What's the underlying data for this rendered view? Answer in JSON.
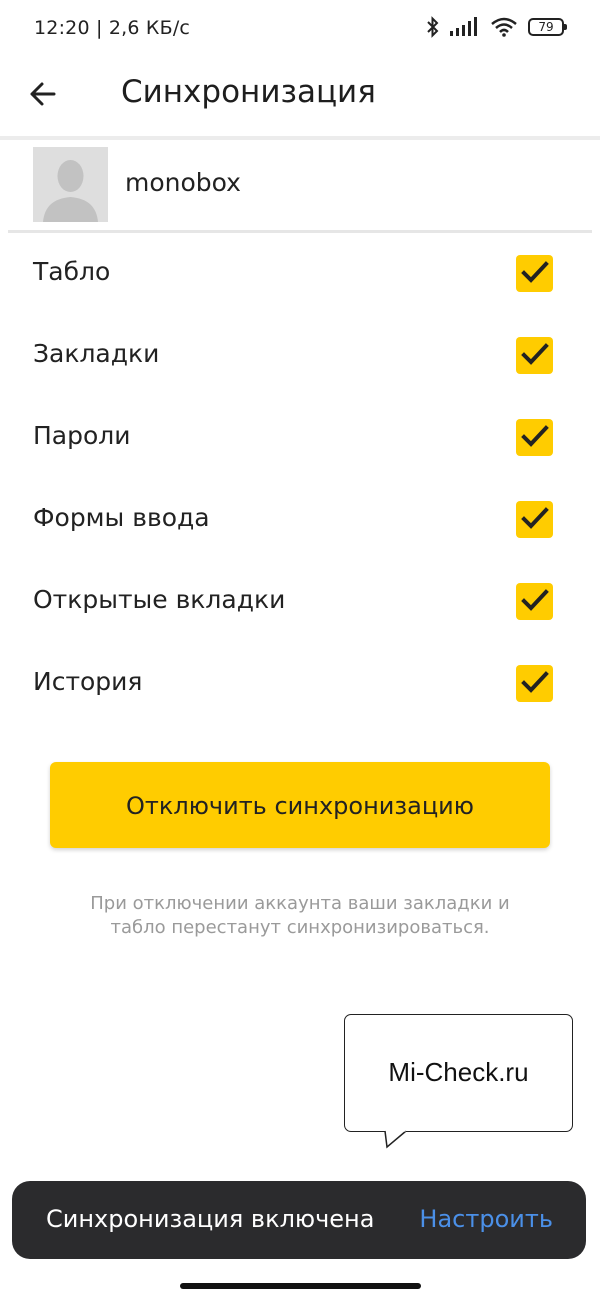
{
  "status_bar": {
    "time_speed": "12:20 | 2,6 КБ/с",
    "battery_level": "79",
    "icons": [
      "bluetooth-icon",
      "signal-icon",
      "wifi-icon",
      "battery-icon"
    ]
  },
  "header": {
    "back_icon": "arrow-left-icon",
    "title": "Синхронизация"
  },
  "account": {
    "avatar_icon": "default-avatar-icon",
    "name": "monobox"
  },
  "options": [
    {
      "label": "Табло",
      "checked": true
    },
    {
      "label": "Закладки",
      "checked": true
    },
    {
      "label": "Пароли",
      "checked": true
    },
    {
      "label": "Формы ввода",
      "checked": true
    },
    {
      "label": "Открытые вкладки",
      "checked": true
    },
    {
      "label": "История",
      "checked": true
    }
  ],
  "disable_button": {
    "label": "Отключить синхронизацию"
  },
  "hint": {
    "text": "При отключении аккаунта ваши закладки и табло перестанут синхронизироваться."
  },
  "watermark": {
    "text": "Mi-Check.ru"
  },
  "snackbar": {
    "message": "Синхронизация включена",
    "action": "Настроить"
  },
  "colors": {
    "accent_yellow": "#ffcc00",
    "snackbar_bg": "#2b2b2d",
    "link_blue": "#4b90e8",
    "hint_gray": "#9a9a9a"
  }
}
